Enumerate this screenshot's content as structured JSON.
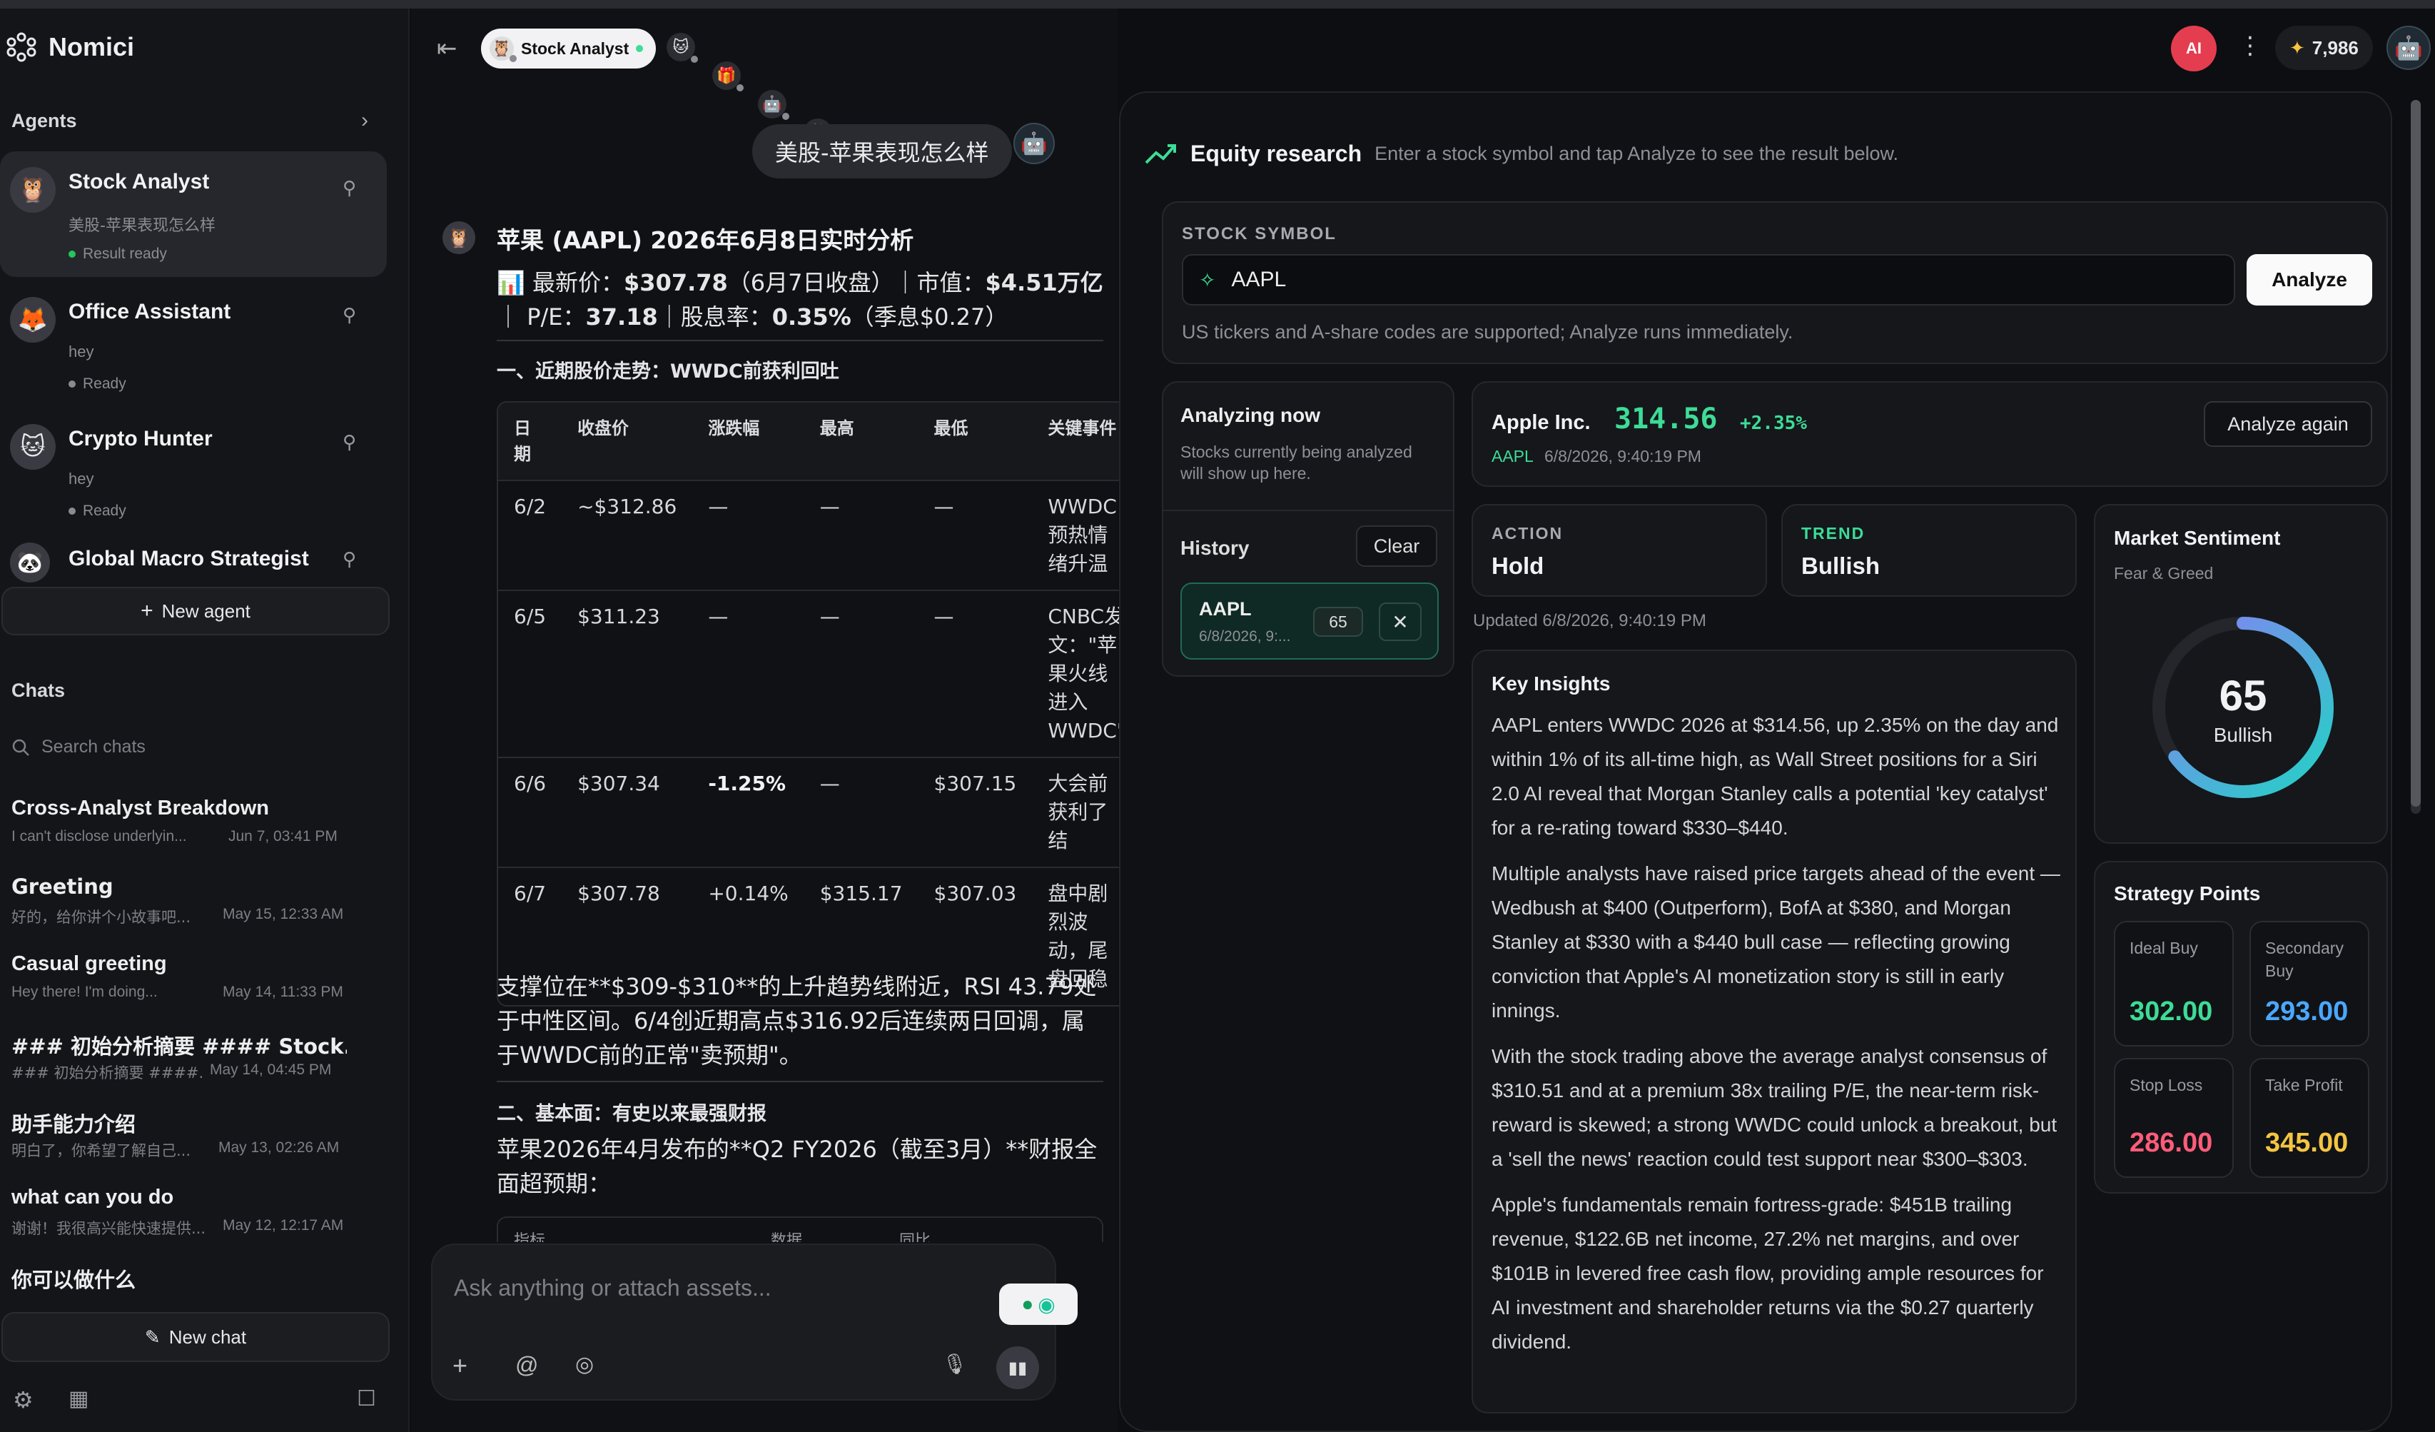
{
  "app": {
    "name": "Nomici"
  },
  "sidebar": {
    "agents_label": "Agents",
    "agents": [
      {
        "name": "Stock Analyst",
        "sub": "美股-苹果表现怎么样",
        "status": "Result ready",
        "avatar": "owl"
      },
      {
        "name": "Office Assistant",
        "sub": "hey",
        "status": "Ready",
        "avatar": "fox"
      },
      {
        "name": "Crypto Hunter",
        "sub": "hey",
        "status": "Ready",
        "avatar": "cat"
      },
      {
        "name": "Global Macro Strategist",
        "sub": "",
        "status": "",
        "avatar": "panda"
      }
    ],
    "new_agent_label": "New agent",
    "chats_label": "Chats",
    "search_placeholder": "Search chats",
    "chats": [
      {
        "title": "Cross-Analyst Breakdown",
        "preview": "I can't disclose underlyin...",
        "time": "Jun 7, 03:41 PM"
      },
      {
        "title": "Greeting",
        "preview": "好的，给你讲个小故事吧...",
        "time": "May 15, 12:33 AM"
      },
      {
        "title": "Casual greeting",
        "preview": "Hey there! I'm doing...",
        "time": "May 14, 11:33 PM"
      },
      {
        "title": "### 初始分析摘要 #### Stock...",
        "preview": "### 初始分析摘要 ####...",
        "time": "May 14, 04:45 PM"
      },
      {
        "title": "助手能力介绍",
        "preview": "明白了，你希望了解自己...",
        "time": "May 13, 02:26 AM"
      },
      {
        "title": "what can you do",
        "preview": "谢谢！我很高兴能快速提供...",
        "time": "May 12, 12:17 AM"
      },
      {
        "title": "你可以做什么",
        "preview": "",
        "time": ""
      }
    ],
    "new_chat_label": "New chat"
  },
  "topbar": {
    "active_tab": "Stock Analyst",
    "points": "7,986",
    "ai_badge": "AI"
  },
  "chat": {
    "user_message": "美股-苹果表现怎么样",
    "reply_title": "苹果 (AAPL) 2026年6月8日实时分析",
    "summary": {
      "icon": "📊",
      "price_label": "最新价：",
      "price": "$307.78",
      "price_note": "（6月7日收盘）｜市值：",
      "mcap": "$4.51万亿",
      "sep": "｜",
      "pe_label": "P/E：",
      "pe": "37.18",
      "div_label": "｜股息率：",
      "div": "0.35%",
      "div_note": "（季息$0.27）"
    },
    "section1": "一、近期股价走势：WWDC前获利回吐",
    "table": {
      "headers": [
        "日期",
        "收盘价",
        "涨跌幅",
        "最高",
        "最低",
        "关键事件"
      ],
      "rows": [
        [
          "6/2",
          "~$312.86",
          "—",
          "—",
          "—",
          "WWDC预热情绪升温"
        ],
        [
          "6/5",
          "$311.23",
          "—",
          "—",
          "—",
          "CNBC发文：\"苹果火线进入WWDC\""
        ],
        [
          "6/6",
          "$307.34",
          "-1.25%",
          "—",
          "$307.15",
          "大会前获利了结"
        ],
        [
          "6/7",
          "$307.78",
          "+0.14%",
          "$315.17",
          "$307.03",
          "盘中剧烈波动，尾盘回稳"
        ]
      ]
    },
    "support_text": "支撑位在**$309-$310**的上升趋势线附近，RSI 43.79处于中性区间。6/4创近期高点$316.92后连续两日回调，属于WWDC前的正常\"卖预期\"。",
    "section2": "二、基本面：有史以来最强财报",
    "fund_text": "苹果2026年4月发布的**Q2 FY2026（截至3月）**财报全面超预期：",
    "table2_headers": [
      "指标",
      "数据",
      "同比"
    ],
    "composer_placeholder": "Ask anything or attach assets..."
  },
  "equity": {
    "title": "Equity research",
    "subtitle": "Enter a stock symbol and tap Analyze to see the result below.",
    "symbol_label": "STOCK SYMBOL",
    "symbol_value": "AAPL",
    "analyze_label": "Analyze",
    "hint": "US tickers and A-share codes are supported; Analyze runs immediately.",
    "analyzing_title": "Analyzing now",
    "analyzing_sub": "Stocks currently being analyzed will show up here.",
    "history_label": "History",
    "clear_label": "Clear",
    "history_item": {
      "symbol": "AAPL",
      "date": "6/8/2026, 9:...",
      "score": "65"
    },
    "quote": {
      "company": "Apple Inc.",
      "price": "314.56",
      "change": "+2.35%",
      "ticker": "AAPL",
      "timestamp": "6/8/2026, 9:40:19 PM",
      "again_label": "Analyze again"
    },
    "action": {
      "label": "ACTION",
      "value": "Hold"
    },
    "trend": {
      "label": "TREND",
      "value": "Bullish"
    },
    "updated": "Updated 6/8/2026, 9:40:19 PM",
    "insights_title": "Key Insights",
    "insights": [
      "AAPL enters WWDC 2026 at $314.56, up 2.35% on the day and within 1% of its all-time high, as Wall Street positions for a Siri 2.0 AI reveal that Morgan Stanley calls a potential 'key catalyst' for a re-rating toward $330–$440.",
      "Multiple analysts have raised price targets ahead of the event — Wedbush at $400 (Outperform), BofA at $380, and Morgan Stanley at $330 with a $440 bull case — reflecting growing conviction that Apple's AI monetization story is still in early innings.",
      "With the stock trading above the average analyst consensus of $310.51 and at a premium 38x trailing P/E, the near-term risk-reward is skewed; a strong WWDC could unlock a breakout, but a 'sell the news' reaction could test support near $300–$303.",
      "Apple's fundamentals remain fortress-grade: $451B trailing revenue, $122.6B net income, 27.2% net margins, and over $101B in levered free cash flow, providing ample resources for AI investment and shareholder returns via the $0.27 quarterly dividend."
    ],
    "sentiment": {
      "title": "Market Sentiment",
      "sub": "Fear & Greed",
      "score": 65,
      "label": "Bullish"
    },
    "strategy": {
      "title": "Strategy Points",
      "items": [
        {
          "label": "Ideal Buy",
          "value": "302.00",
          "color": "#3ddc97"
        },
        {
          "label": "Secondary Buy",
          "value": "293.00",
          "color": "#4aa8ff"
        },
        {
          "label": "Stop Loss",
          "value": "286.00",
          "color": "#ff5c7a"
        },
        {
          "label": "Take Profit",
          "value": "345.00",
          "color": "#f5c542"
        }
      ]
    }
  },
  "colors": {
    "accent_green": "#3ddc97",
    "ready_green": "#22c55e",
    "ring_start": "#22d3c5",
    "ring_end": "#8b7cf6"
  }
}
